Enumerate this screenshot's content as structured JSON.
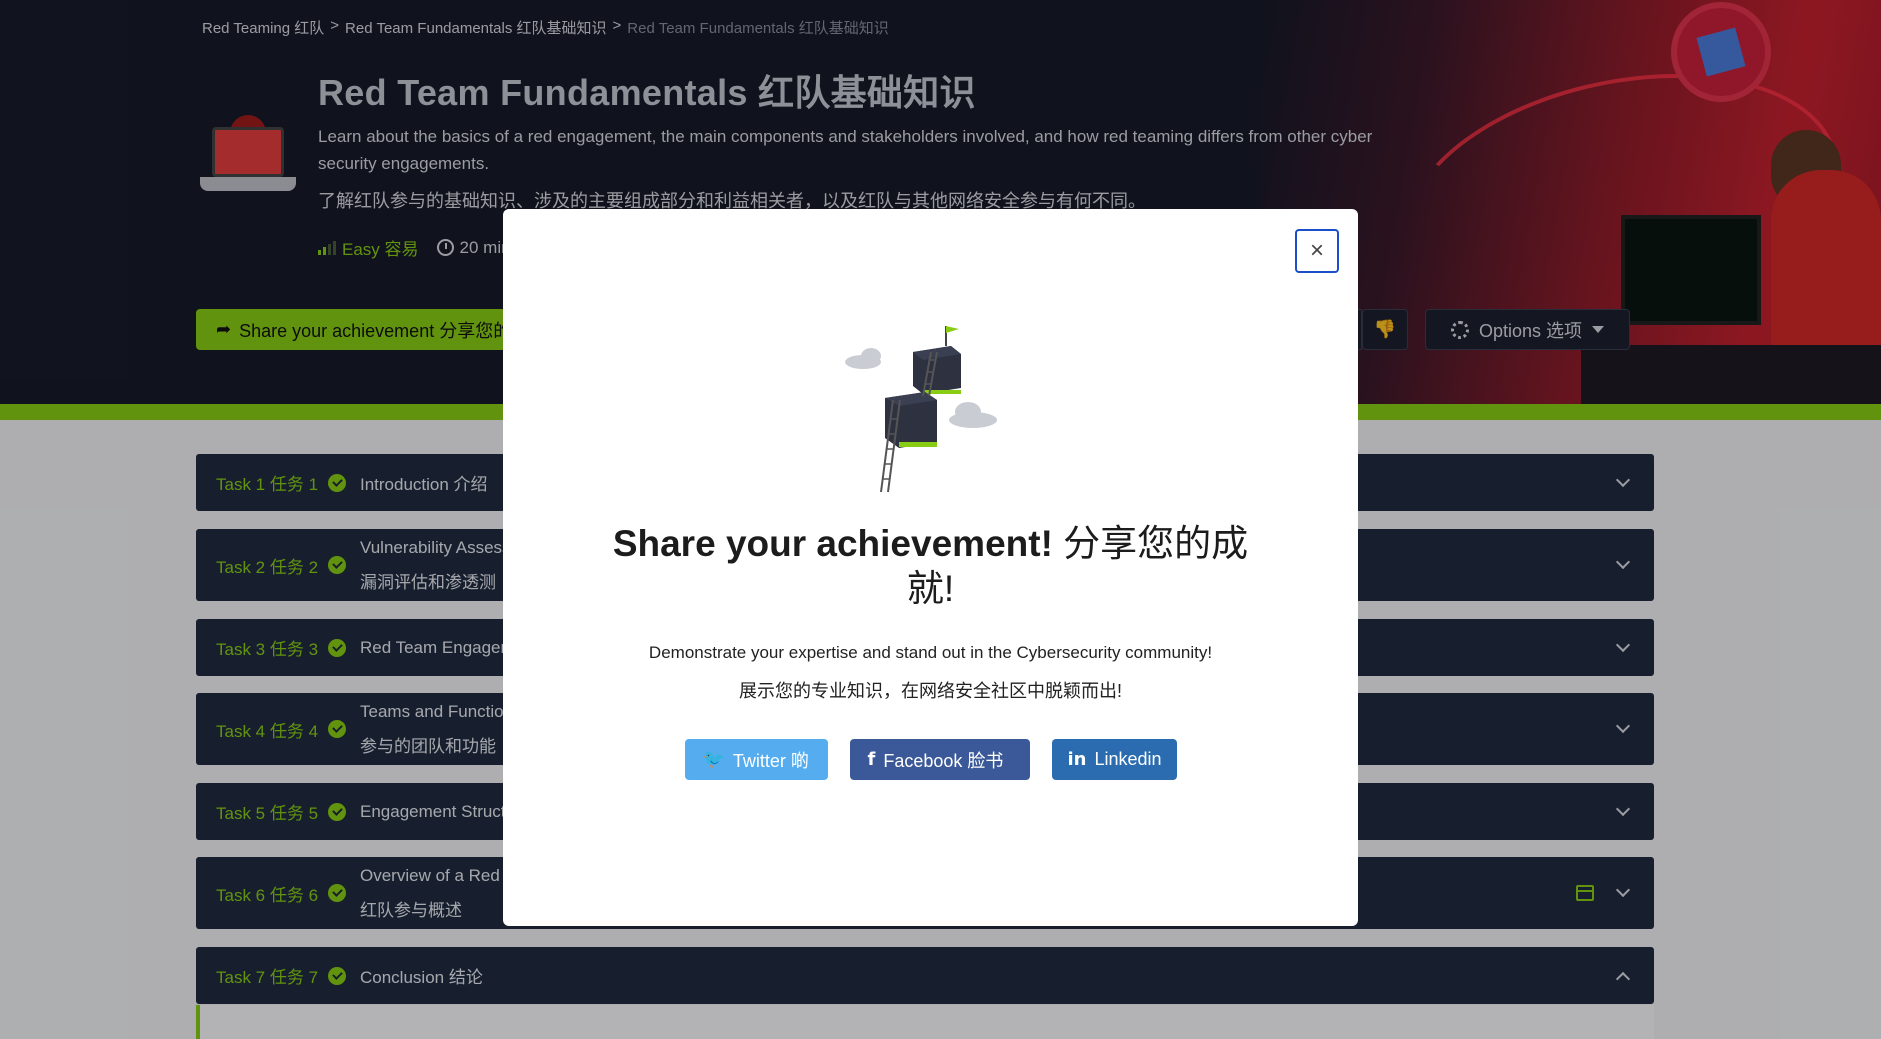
{
  "breadcrumb": {
    "items": [
      "Red Teaming 红队",
      "Red Team Fundamentals 红队基础知识",
      "Red Team Fundamentals 红队基础知识"
    ],
    "separator": ">"
  },
  "room": {
    "title": "Red Team Fundamentals  红队基础知识",
    "description": "Learn about the basics of a red engagement, the main components and stakeholders involved, and how red teaming differs from other cyber security engagements.",
    "description_cn": "了解红队参与的基础知识、涉及的主要组成部分和利益相关者，以及红队与其他网络安全参与有何不同。",
    "difficulty": "Easy 容易",
    "duration": "20 min",
    "icon": "laptop-hacker-icon"
  },
  "actions": {
    "share_label": "Share your achievement 分享您的",
    "options_label": "Options 选项",
    "dislike_icon": "thumbs-down-icon"
  },
  "tasks": [
    {
      "num": "Task 1 任务 1",
      "name": "Introduction 介绍",
      "name2": ""
    },
    {
      "num": "Task 2 任务 2",
      "name": "Vulnerability Assess",
      "name2": "漏洞评估和渗透测"
    },
    {
      "num": "Task 3 任务 3",
      "name": "Red Team Engagem",
      "name2": ""
    },
    {
      "num": "Task 4 任务 4",
      "name": "Teams and Functio",
      "name2": "参与的团队和功能"
    },
    {
      "num": "Task 5 任务 5",
      "name": "Engagement Struct",
      "name2": ""
    },
    {
      "num": "Task 6 任务 6",
      "name": "Overview of a Red T",
      "name2": "红队参与概述"
    },
    {
      "num": "Task 7 任务 7",
      "name": "Conclusion 结论",
      "name2": ""
    }
  ],
  "modal": {
    "close_label": "×",
    "title": "Share your achievement!",
    "title_cn": "分享您的成就!",
    "subtitle": "Demonstrate your expertise and stand out in the Cybersecurity community!",
    "subtitle_cn": "展示您的专业知识，在网络安全社区中脱颖而出!",
    "buttons": {
      "twitter": "Twitter 啲",
      "facebook": "Facebook 脸书",
      "linkedin": "Linkedin"
    }
  },
  "colors": {
    "accent": "#88cc14",
    "header_bg": "#171a29",
    "task_bg": "#212c42",
    "twitter": "#55acee",
    "facebook": "#3b5998",
    "linkedin": "#2b6cb0"
  }
}
